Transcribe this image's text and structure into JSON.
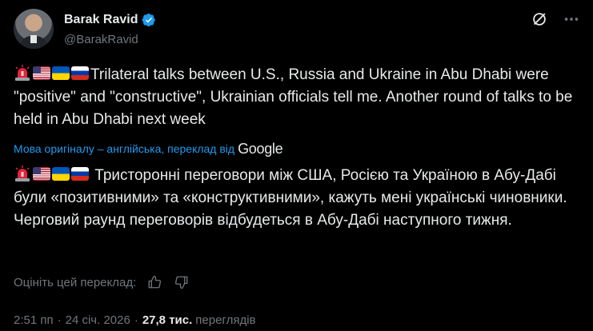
{
  "author": {
    "name": "Barak Ravid",
    "handle": "@BarakRavid",
    "verified_color": "#1d9bf0"
  },
  "tweet": {
    "original_text": "Trilateral talks between U.S., Russia and Ukraine in Abu Dhabi were \"positive\" and \"constructive\", Ukrainian officials tell me. Another round of talks to be held in Abu Dhabi next week",
    "translation_note": "Мова оригіналу – англійська, переклад від",
    "translation_provider": "Google",
    "translated_text": "Тристоронні переговори між США, Росією та Україною в Абу-Дабі були «позитивними» та «конструктивними», кажуть мені українські чиновники. Черговий раунд переговорів відбудеться в Абу-Дабі наступного тижня.",
    "emojis": [
      "siren-emoji",
      "us-flag",
      "ukraine-flag",
      "russia-flag"
    ]
  },
  "rating": {
    "label": "Оцініть цей переклад:",
    "thumbs_up_icon": "thumbs-up-icon",
    "thumbs_down_icon": "thumbs-down-icon"
  },
  "meta": {
    "time": "2:51 пп",
    "date": "24 січ. 2026",
    "views_count": "27,8 тис.",
    "views_label": "переглядів"
  },
  "colors": {
    "background": "#000000",
    "text": "#e7e9ea",
    "secondary": "#71767b",
    "accent": "#1d9bf0"
  }
}
